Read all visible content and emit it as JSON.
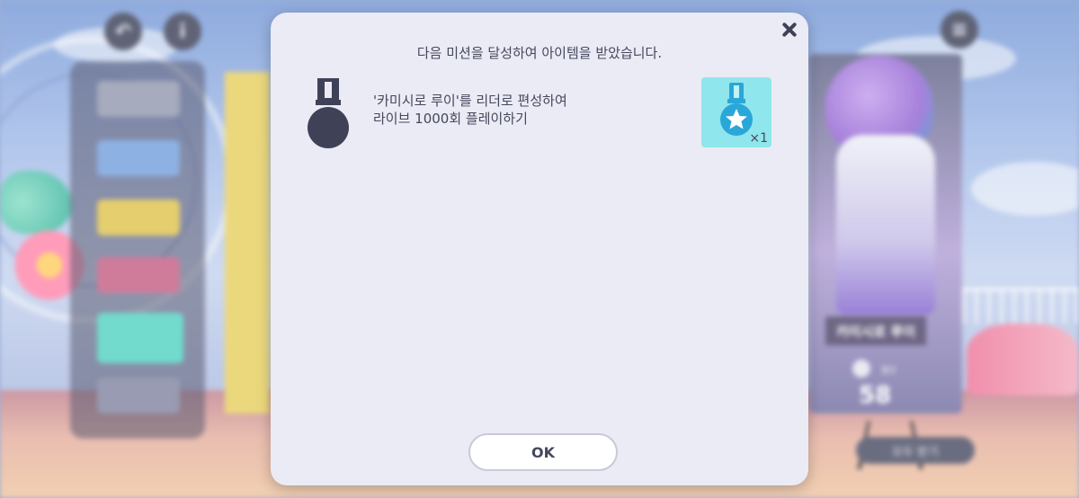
{
  "dialog": {
    "header": "다음 미션을 달성하여 아이템을 받았습니다.",
    "mission": {
      "line1": "'카미시로 루이'를 리더로 편성하여",
      "line2": "라이브 1000회 플레이하기",
      "icon": "medal-mission-icon"
    },
    "reward": {
      "icon": "blue-star-medal-icon",
      "quantity": "×1"
    },
    "ok_label": "OK",
    "close_icon": "close-icon"
  },
  "background": {
    "character_name": "카미시로 루이",
    "rank_label": "랭크",
    "rank_value": "58",
    "claim_all_label": "모두 받기",
    "back_icon": "back-arrow-icon",
    "info_icon": "info-icon",
    "menu_icon": "menu-icon"
  },
  "colors": {
    "dialog_bg": "#ebebf5",
    "text": "#45485d",
    "reward_bg": "#8fe6ec"
  }
}
